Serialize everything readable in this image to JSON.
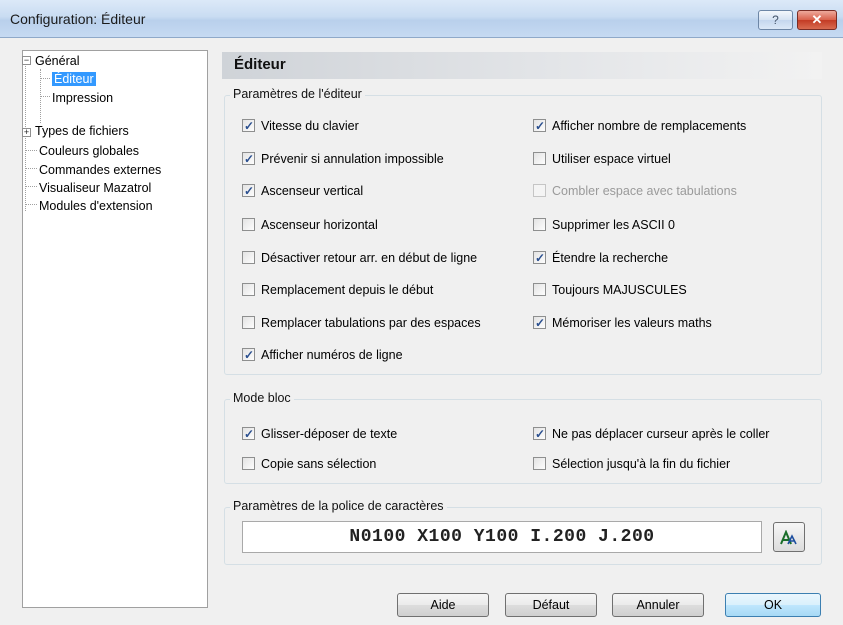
{
  "window": {
    "title": "Configuration: Éditeur",
    "help_label": "?",
    "close_label": "✕"
  },
  "tree": {
    "items": [
      {
        "label": "Général",
        "expander": "−"
      },
      {
        "label": "Éditeur"
      },
      {
        "label": "Impression"
      },
      {
        "label": "Types de fichiers",
        "expander": "+"
      },
      {
        "label": "Couleurs globales"
      },
      {
        "label": "Commandes externes"
      },
      {
        "label": "Visualiseur Mazatrol"
      },
      {
        "label": "Modules d'extension"
      }
    ]
  },
  "panel": {
    "title": "Éditeur"
  },
  "editor_params": {
    "label": "Paramètres de l'éditeur",
    "left": [
      {
        "label": "Vitesse du clavier",
        "checked": true
      },
      {
        "label": "Prévenir si annulation impossible",
        "checked": true
      },
      {
        "label": "Ascenseur vertical",
        "checked": true
      },
      {
        "label": "Ascenseur horizontal",
        "checked": false
      },
      {
        "label": "Désactiver retour arr. en début de ligne",
        "checked": false
      },
      {
        "label": "Remplacement depuis le début",
        "checked": false
      },
      {
        "label": "Remplacer tabulations par des espaces",
        "checked": false
      },
      {
        "label": "Afficher numéros de ligne",
        "checked": true
      }
    ],
    "right": [
      {
        "label": "Afficher nombre de remplacements",
        "checked": true
      },
      {
        "label": "Utiliser espace virtuel",
        "checked": false
      },
      {
        "label": "Combler espace avec tabulations",
        "checked": false,
        "disabled": true
      },
      {
        "label": "Supprimer les ASCII 0",
        "checked": false
      },
      {
        "label": "Étendre la recherche",
        "checked": true
      },
      {
        "label": "Toujours MAJUSCULES",
        "checked": false
      },
      {
        "label": "Mémoriser les valeurs maths",
        "checked": true
      }
    ]
  },
  "block_mode": {
    "label": "Mode bloc",
    "left": [
      {
        "label": "Glisser-déposer de texte",
        "checked": true
      },
      {
        "label": "Copie sans sélection",
        "checked": false
      }
    ],
    "right": [
      {
        "label": "Ne pas déplacer curseur après le coller",
        "checked": true
      },
      {
        "label": "Sélection jusqu'à la fin du fichier",
        "checked": false
      }
    ]
  },
  "font_params": {
    "label": "Paramètres de la police de caractères",
    "preview": "N0100 X100 Y100 I.200 J.200",
    "font_button_icon": "font-icon"
  },
  "buttons": {
    "help": "Aide",
    "default": "Défaut",
    "cancel": "Annuler",
    "ok": "OK"
  }
}
